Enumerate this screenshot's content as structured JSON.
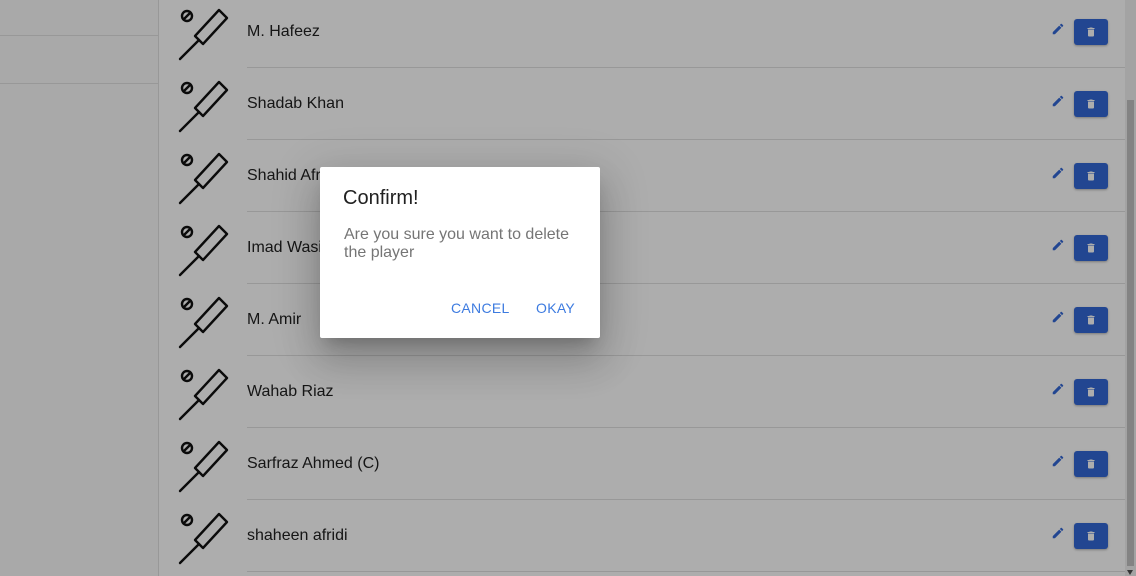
{
  "players": [
    {
      "name": "M. Hafeez"
    },
    {
      "name": "Shadab Khan"
    },
    {
      "name": "Shahid Afridi"
    },
    {
      "name": "Imad Wasim"
    },
    {
      "name": "M. Amir"
    },
    {
      "name": "Wahab Riaz"
    },
    {
      "name": "Sarfraz Ahmed (C)"
    },
    {
      "name": "shaheen afridi"
    }
  ],
  "icons": {
    "player": "cricket-bat-ball-icon",
    "edit": "pencil-icon",
    "delete": "trash-icon"
  },
  "colors": {
    "accent": "#3367d6",
    "dialog_button": "#3d7be0"
  },
  "dialog": {
    "title": "Confirm!",
    "message": "Are you sure you want to delete the player",
    "cancel_label": "CANCEL",
    "okay_label": "OKAY"
  }
}
